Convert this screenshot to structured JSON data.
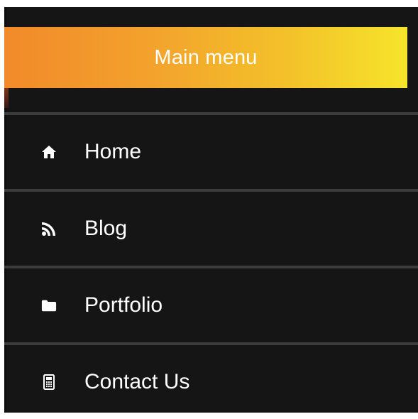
{
  "header": {
    "title": "Main menu"
  },
  "menu": {
    "items": [
      {
        "label": "Home",
        "icon": "home-icon"
      },
      {
        "label": "Blog",
        "icon": "rss-icon"
      },
      {
        "label": "Portfolio",
        "icon": "folder-icon"
      },
      {
        "label": "Contact Us",
        "icon": "calculator-icon"
      }
    ]
  },
  "colors": {
    "header_gradient_start": "#f28a2a",
    "header_gradient_end": "#f6e42b",
    "panel_background": "#151515",
    "divider": "#3c3c3c",
    "text": "#ffffff"
  }
}
